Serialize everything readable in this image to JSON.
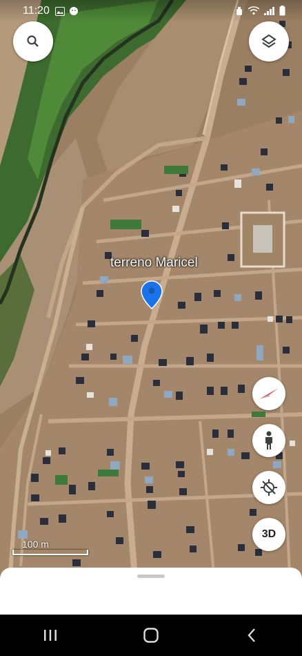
{
  "status_bar": {
    "time": "11:20",
    "left_icons": [
      "gallery-icon",
      "android-icon"
    ],
    "right_icons": [
      "alarm-icon",
      "wifi-icon",
      "signal-icon",
      "battery-icon"
    ]
  },
  "map": {
    "place_label": "terreno Maricel",
    "scale_label": "100 m"
  },
  "controls": {
    "search_icon": "search-icon",
    "layers_icon": "layers-icon",
    "compass_icon": "compass-icon",
    "street_view_icon": "pegman-icon",
    "location_icon": "location-off-icon",
    "btn_3d_label": "3D"
  },
  "colors": {
    "pin": "#1a73e8",
    "compass_red": "#e53935"
  },
  "nav_bar": {
    "buttons": [
      "recent-apps-icon",
      "home-icon",
      "back-icon"
    ]
  }
}
